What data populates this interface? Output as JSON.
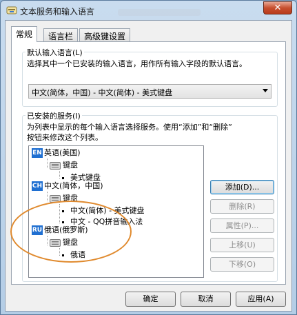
{
  "window": {
    "title": "文本服务和输入语言",
    "close_label": "✕"
  },
  "tabs": [
    {
      "label": "常规"
    },
    {
      "label": "语言栏"
    },
    {
      "label": "高级键设置"
    }
  ],
  "default_language": {
    "group_label": "默认输入语言(L)",
    "description": "选择其中一个已安装的输入语言，用作所有输入字段的默认语言。",
    "selected_value": "中文(简体，中国) - 中文(简体) - 美式键盘"
  },
  "installed_services": {
    "group_label": "已安装的服务(I)",
    "description_line1": "为列表中显示的每个输入语言选择服务。使用“添加”和“删除”",
    "description_line2": "按钮来修改这个列表。",
    "tree": {
      "en": {
        "badge": "EN",
        "badge_color": "#1f6fd1",
        "language": "英语(美国)",
        "category": "键盘",
        "item": "美式键盘"
      },
      "ch": {
        "badge": "CH",
        "badge_color": "#1f6fd1",
        "language": "中文(简体，中国)",
        "category": "键盘",
        "item1": "中文(简体) - 美式键盘",
        "item2": "中文 - QQ拼音输入法"
      },
      "ru": {
        "badge": "RU",
        "badge_color": "#1f6fd1",
        "language": "俄语(俄罗斯)",
        "category": "键盘",
        "item": "俄语"
      }
    },
    "buttons": {
      "add": "添加(D)...",
      "remove": "删除(R)",
      "properties": "属性(P)...",
      "move_up": "上移(U)",
      "move_down": "下移(O)"
    }
  },
  "footer": {
    "ok": "确定",
    "cancel": "取消",
    "apply": "应用(A)"
  },
  "colors": {
    "annotation_circle": "#e08a2e",
    "close_button": "#c74f2e"
  }
}
